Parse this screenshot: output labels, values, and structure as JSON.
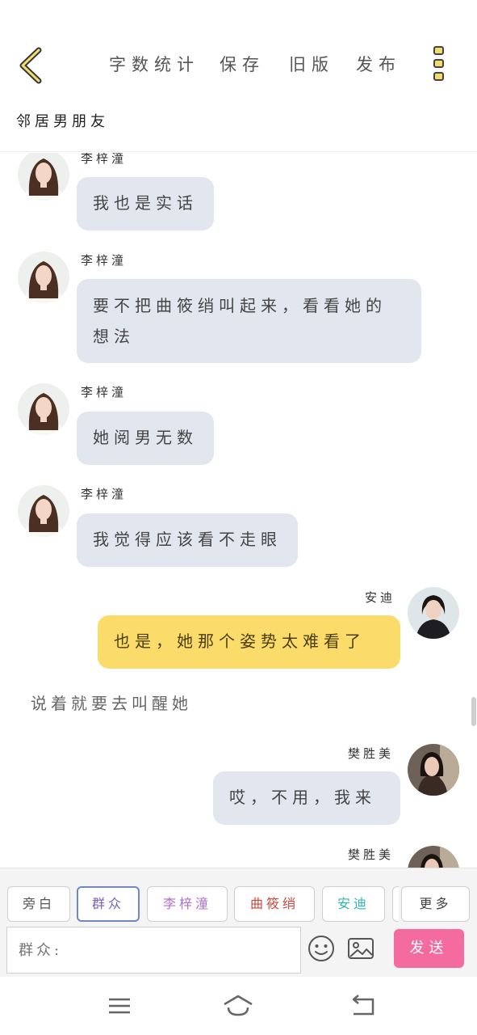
{
  "header": {
    "menu": [
      "字数统计",
      "保存",
      "旧版",
      "发布"
    ],
    "story_title": "邻居男朋友"
  },
  "messages": [
    {
      "sender": "李梓潼",
      "text": "我也是实话",
      "side": "left"
    },
    {
      "sender": "李梓潼",
      "text": "要不把曲筱绡叫起来，看看她的想法",
      "side": "left"
    },
    {
      "sender": "李梓潼",
      "text": "她阅男无数",
      "side": "left"
    },
    {
      "sender": "李梓潼",
      "text": "我觉得应该看不走眼",
      "side": "left"
    },
    {
      "sender": "安迪",
      "text": "也是，她那个姿势太难看了",
      "side": "right"
    },
    {
      "narration": "说着就要去叫醒她"
    },
    {
      "sender": "樊胜美",
      "text": "哎，不用，我来",
      "side": "right"
    },
    {
      "sender": "樊胜美",
      "text": "",
      "side": "right"
    }
  ],
  "composer": {
    "roles": [
      {
        "label": "旁白",
        "color": "#555555"
      },
      {
        "label": "群众",
        "color": "#7a5fb5"
      },
      {
        "label": "李梓潼",
        "color": "#b06fd0"
      },
      {
        "label": "曲筱绡",
        "color": "#d0453a"
      },
      {
        "label": "安迪",
        "color": "#2fb6b6"
      },
      {
        "label": "更多",
        "color": "#444444"
      }
    ],
    "input_placeholder": "群众:",
    "send_label": "发送"
  },
  "icons": [
    "back-chevron-icon",
    "more-vertical-icon",
    "emoji-icon",
    "image-icon",
    "nav-menu-icon",
    "nav-home-icon",
    "nav-back-icon"
  ]
}
